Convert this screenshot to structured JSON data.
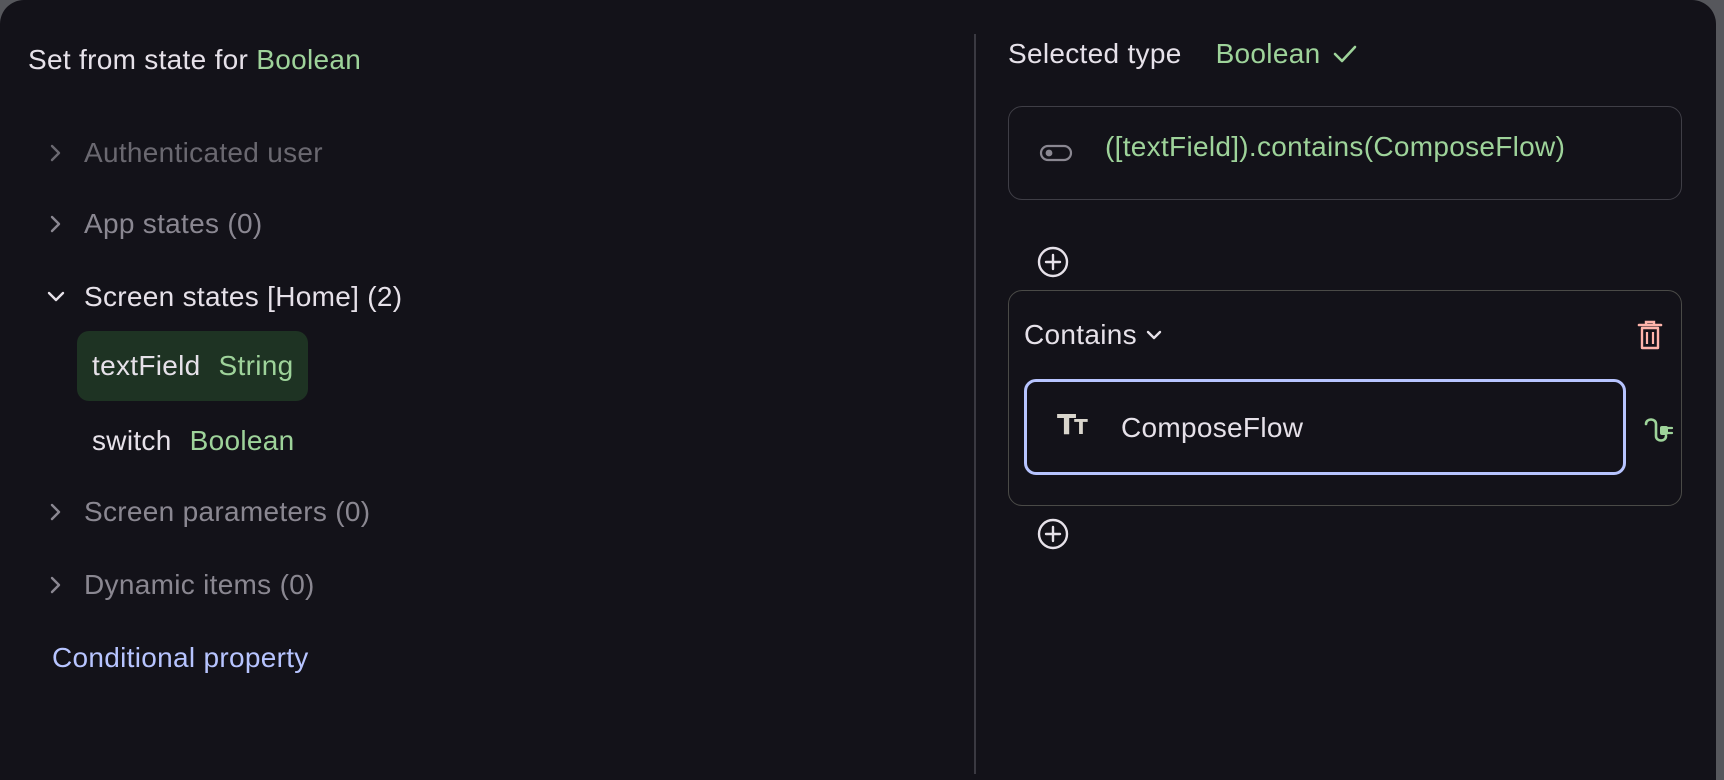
{
  "dialog": {
    "title_prefix": "Set from state for",
    "title_type": "Boolean"
  },
  "tree": {
    "authenticated_user": "Authenticated user",
    "app_states": "App states (0)",
    "screen_states": "Screen states [Home] (2)",
    "screen_state_items": [
      {
        "name": "textField",
        "type": "String",
        "selected": true
      },
      {
        "name": "switch",
        "type": "Boolean",
        "selected": false
      }
    ],
    "screen_parameters": "Screen parameters (0)",
    "dynamic_items": "Dynamic items (0)"
  },
  "conditional_link": "Conditional property",
  "right": {
    "selected_type_label": "Selected type",
    "selected_type_value": "Boolean",
    "expression": "([textField]).contains(ComposeFlow)",
    "transform": {
      "operator": "Contains",
      "value": "ComposeFlow"
    }
  },
  "colors": {
    "background": "#131219",
    "accent_green": "#9ed39a",
    "link_blue": "#b7c4ff",
    "selected_bg": "#1e3323",
    "delete_red": "#ffb4ab"
  },
  "icons": {
    "expand": "chevron-right-icon",
    "collapse": "chevron-down-icon",
    "check": "check-icon",
    "toggle": "toggle-icon",
    "add": "add-circle-icon",
    "delete": "delete-icon",
    "text_type": "text-type-icon",
    "plug": "plug-icon"
  }
}
